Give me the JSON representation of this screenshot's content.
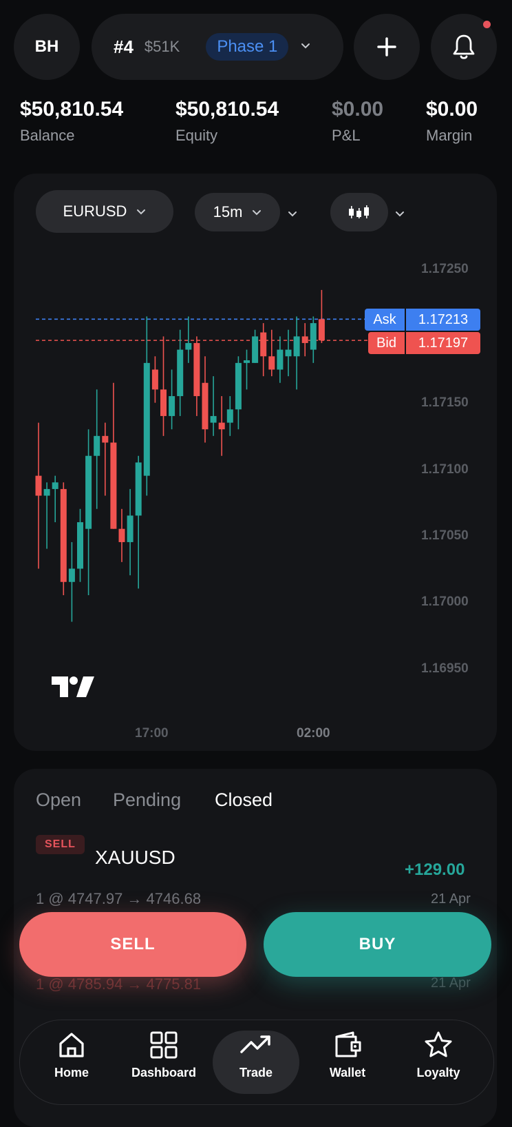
{
  "header": {
    "avatar_initials": "BH",
    "account_number": "#4",
    "account_size": "$51K",
    "phase_label": "Phase 1",
    "add_icon": "plus-icon",
    "notification_icon": "bell-icon"
  },
  "stats": [
    {
      "value": "$50,810.54",
      "label": "Balance"
    },
    {
      "value": "$50,810.54",
      "label": "Equity"
    },
    {
      "value": "$0.00",
      "label": "P&L"
    },
    {
      "value": "$0.00",
      "label": "Margin"
    }
  ],
  "chart": {
    "symbol": "EURUSD",
    "interval": "15m",
    "chart_type_icon": "candlestick-icon",
    "ask_label": "Ask",
    "ask_price": "1.17213",
    "bid_label": "Bid",
    "bid_price": "1.17197",
    "y_ticks": [
      "1.17250",
      "1.17150",
      "1.17100",
      "1.17050",
      "1.17000",
      "1.16950"
    ],
    "x_ticks": [
      "17:00",
      "02:00"
    ],
    "logo_icon": "tradingview-logo-icon",
    "colors": {
      "up": "#26a69a",
      "down": "#ef5350",
      "ask": "#3d7ff0",
      "bid": "#ef5350"
    }
  },
  "trades": {
    "tabs": [
      "Open",
      "Pending",
      "Closed"
    ],
    "active_tab": "Closed",
    "items": [
      {
        "side": "SELL",
        "symbol": "XAUUSD",
        "pnl": "+129.00",
        "detail": "1 @ 4747.97 → 4746.68",
        "date": "21 Apr"
      },
      {
        "detail": "1 @ 4785.94 → 4775.81",
        "date": "21 Apr"
      }
    ]
  },
  "actions": {
    "sell_label": "SELL",
    "buy_label": "BUY",
    "sell_color": "#f26d6d",
    "buy_color": "#2aa89a"
  },
  "nav": [
    {
      "label": "Home",
      "icon": "home-icon"
    },
    {
      "label": "Dashboard",
      "icon": "dashboard-icon"
    },
    {
      "label": "Trade",
      "icon": "trend-up-icon"
    },
    {
      "label": "Wallet",
      "icon": "wallet-icon"
    },
    {
      "label": "Loyalty",
      "icon": "star-icon"
    }
  ],
  "chart_data": {
    "type": "candlestick",
    "title": "",
    "symbol": "EURUSD",
    "interval": "15m",
    "ylim": [
      1.1693,
      1.1727
    ],
    "y_ticks": [
      1.1725,
      1.1715,
      1.171,
      1.1705,
      1.17,
      1.1695
    ],
    "x_ticks": [
      "17:00",
      "02:00"
    ],
    "ask": 1.17213,
    "bid": 1.17197,
    "candles": [
      {
        "o": 1.17095,
        "h": 1.17135,
        "l": 1.17025,
        "c": 1.1708
      },
      {
        "o": 1.1708,
        "h": 1.1709,
        "l": 1.1704,
        "c": 1.17085
      },
      {
        "o": 1.17085,
        "h": 1.17095,
        "l": 1.1706,
        "c": 1.1709
      },
      {
        "o": 1.17085,
        "h": 1.1709,
        "l": 1.17005,
        "c": 1.17015
      },
      {
        "o": 1.17015,
        "h": 1.17045,
        "l": 1.16985,
        "c": 1.17025
      },
      {
        "o": 1.17025,
        "h": 1.1707,
        "l": 1.17015,
        "c": 1.1706
      },
      {
        "o": 1.17055,
        "h": 1.1713,
        "l": 1.17005,
        "c": 1.1711
      },
      {
        "o": 1.1711,
        "h": 1.1716,
        "l": 1.1707,
        "c": 1.17125
      },
      {
        "o": 1.17125,
        "h": 1.17135,
        "l": 1.1708,
        "c": 1.1712
      },
      {
        "o": 1.1712,
        "h": 1.17165,
        "l": 1.17055,
        "c": 1.17055
      },
      {
        "o": 1.17055,
        "h": 1.1707,
        "l": 1.1703,
        "c": 1.17045
      },
      {
        "o": 1.17045,
        "h": 1.17085,
        "l": 1.1702,
        "c": 1.17065
      },
      {
        "o": 1.17065,
        "h": 1.1711,
        "l": 1.1701,
        "c": 1.17105
      },
      {
        "o": 1.17095,
        "h": 1.17215,
        "l": 1.1708,
        "c": 1.1718
      },
      {
        "o": 1.17175,
        "h": 1.17185,
        "l": 1.1715,
        "c": 1.1716
      },
      {
        "o": 1.1716,
        "h": 1.172,
        "l": 1.17125,
        "c": 1.1714
      },
      {
        "o": 1.1714,
        "h": 1.17175,
        "l": 1.1713,
        "c": 1.17155
      },
      {
        "o": 1.17155,
        "h": 1.17205,
        "l": 1.1714,
        "c": 1.1719
      },
      {
        "o": 1.1719,
        "h": 1.17215,
        "l": 1.1718,
        "c": 1.17195
      },
      {
        "o": 1.17195,
        "h": 1.172,
        "l": 1.1714,
        "c": 1.17155
      },
      {
        "o": 1.17165,
        "h": 1.17185,
        "l": 1.1712,
        "c": 1.1713
      },
      {
        "o": 1.17135,
        "h": 1.1717,
        "l": 1.17125,
        "c": 1.1714
      },
      {
        "o": 1.17135,
        "h": 1.17155,
        "l": 1.1711,
        "c": 1.1713
      },
      {
        "o": 1.17135,
        "h": 1.17155,
        "l": 1.17125,
        "c": 1.17145
      },
      {
        "o": 1.17145,
        "h": 1.17185,
        "l": 1.1713,
        "c": 1.1718
      },
      {
        "o": 1.1718,
        "h": 1.1719,
        "l": 1.1716,
        "c": 1.17182
      },
      {
        "o": 1.1718,
        "h": 1.17205,
        "l": 1.1718,
        "c": 1.172
      },
      {
        "o": 1.17203,
        "h": 1.1721,
        "l": 1.1717,
        "c": 1.17185
      },
      {
        "o": 1.17185,
        "h": 1.17205,
        "l": 1.1717,
        "c": 1.17175
      },
      {
        "o": 1.17175,
        "h": 1.172,
        "l": 1.17165,
        "c": 1.1719
      },
      {
        "o": 1.17185,
        "h": 1.17205,
        "l": 1.1717,
        "c": 1.1719
      },
      {
        "o": 1.17185,
        "h": 1.17215,
        "l": 1.1716,
        "c": 1.172
      },
      {
        "o": 1.172,
        "h": 1.1721,
        "l": 1.17185,
        "c": 1.17195
      },
      {
        "o": 1.1719,
        "h": 1.17215,
        "l": 1.1718,
        "c": 1.1721
      },
      {
        "o": 1.17213,
        "h": 1.17235,
        "l": 1.17195,
        "c": 1.17197
      }
    ]
  }
}
